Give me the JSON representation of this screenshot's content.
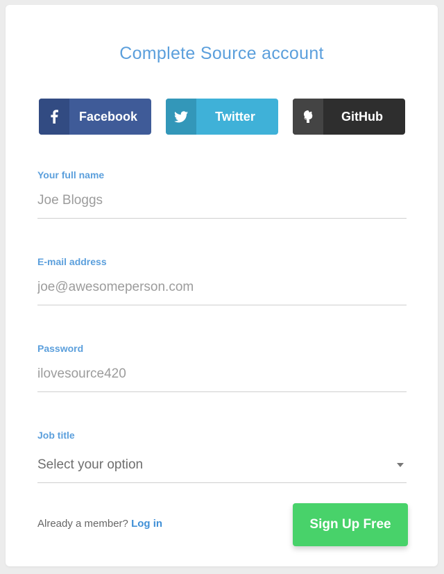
{
  "title": "Complete Source account",
  "social": {
    "facebook": {
      "label": "Facebook",
      "icon": "facebook-icon",
      "color": "#3f5b98"
    },
    "twitter": {
      "label": "Twitter",
      "icon": "twitter-icon",
      "color": "#3fb1d8"
    },
    "github": {
      "label": "GitHub",
      "icon": "github-icon",
      "color": "#2e2e2e"
    }
  },
  "form": {
    "full_name": {
      "label": "Your full name",
      "placeholder": "Joe Bloggs"
    },
    "email": {
      "label": "E-mail address",
      "placeholder": "joe@awesomeperson.com"
    },
    "password": {
      "label": "Password",
      "placeholder": "ilovesource420"
    },
    "job_title": {
      "label": "Job title",
      "selected": "Select your option"
    }
  },
  "footer": {
    "member_text": "Already a member?",
    "login_label": "Log in",
    "signup_label": "Sign Up Free"
  },
  "colors": {
    "accent": "#5b9fdc",
    "signup": "#48d26a"
  }
}
